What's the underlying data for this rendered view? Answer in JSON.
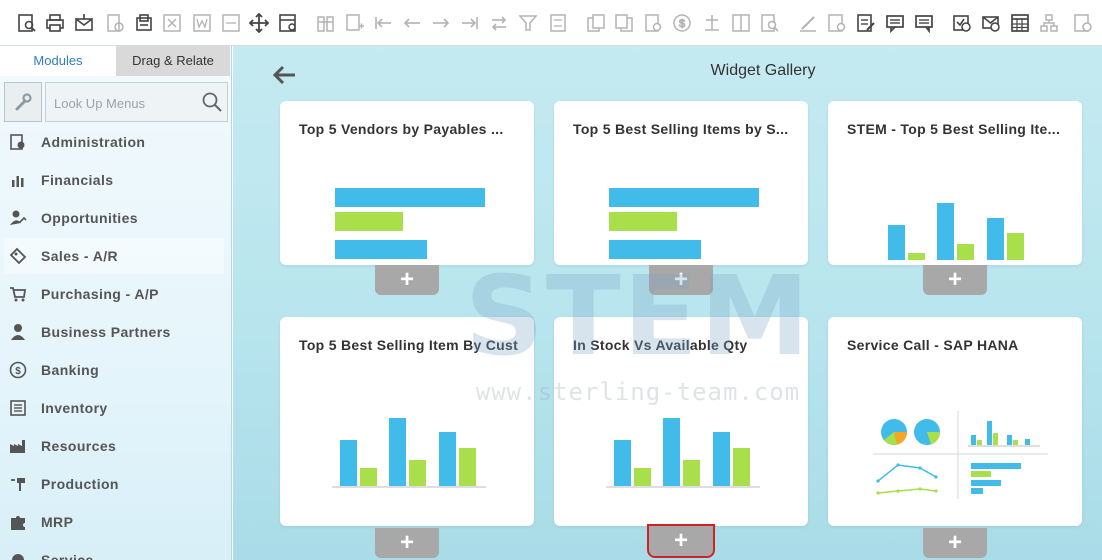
{
  "toolbar": {
    "icons": [
      "preview-icon",
      "print-icon",
      "email-icon",
      "sms-icon",
      "fax-icon",
      "excel-icon",
      "word-icon",
      "pdf-icon",
      "move-icon",
      "form-settings-icon",
      "filter-table-icon",
      "add-row-icon",
      "first-record-icon",
      "previous-record-icon",
      "next-record-icon",
      "last-record-icon",
      "refresh-icon",
      "filter-icon",
      "sort-icon",
      "base-document-icon",
      "target-document-icon",
      "document-icon",
      "payment-icon",
      "balance-icon",
      "cost-icon",
      "find-icon",
      "edit-icon",
      "settings-icon",
      "approval-icon",
      "messages-icon",
      "chat-icon",
      "calendar-alert-icon",
      "email-alert-icon",
      "calendar-icon",
      "network-icon",
      "clock-icon"
    ]
  },
  "sidebar": {
    "tabs": [
      "Modules",
      "Drag & Relate"
    ],
    "search_placeholder": "Look Up Menus",
    "items": [
      {
        "label": "Administration",
        "icon": "administration-icon"
      },
      {
        "label": "Financials",
        "icon": "financials-icon"
      },
      {
        "label": "Opportunities",
        "icon": "opportunities-icon"
      },
      {
        "label": "Sales - A/R",
        "icon": "sales-icon"
      },
      {
        "label": "Purchasing - A/P",
        "icon": "cart-icon"
      },
      {
        "label": "Business Partners",
        "icon": "person-icon"
      },
      {
        "label": "Banking",
        "icon": "dollar-icon"
      },
      {
        "label": "Inventory",
        "icon": "inventory-icon"
      },
      {
        "label": "Resources",
        "icon": "factory-icon"
      },
      {
        "label": "Production",
        "icon": "production-icon"
      },
      {
        "label": "MRP",
        "icon": "puzzle-icon"
      },
      {
        "label": "Service",
        "icon": "service-icon"
      }
    ]
  },
  "main": {
    "title": "Widget Gallery",
    "add_label": "+",
    "cards": [
      {
        "title": "Top 5 Vendors by Payables ...",
        "chart": "hbar"
      },
      {
        "title": "Top 5 Best Selling Items by S...",
        "chart": "hbar"
      },
      {
        "title": "STEM - Top 5 Best Selling Ite...",
        "chart": "vbar"
      },
      {
        "title": "Top 5 Best Selling Item By Cust",
        "chart": "vbar"
      },
      {
        "title": "In Stock Vs Available Qty",
        "chart": "vbar"
      },
      {
        "title": "Service Call - SAP HANA",
        "chart": "mixed"
      }
    ]
  },
  "watermark": {
    "logo": "STEM",
    "url": "www.sterling-team.com"
  },
  "colors": {
    "bar_blue": "#41bbe9",
    "bar_green": "#a8df4a",
    "add_button": "#a8a8a8",
    "selected_outline": "#d32027",
    "active_tab_text": "#2f7fb8"
  }
}
